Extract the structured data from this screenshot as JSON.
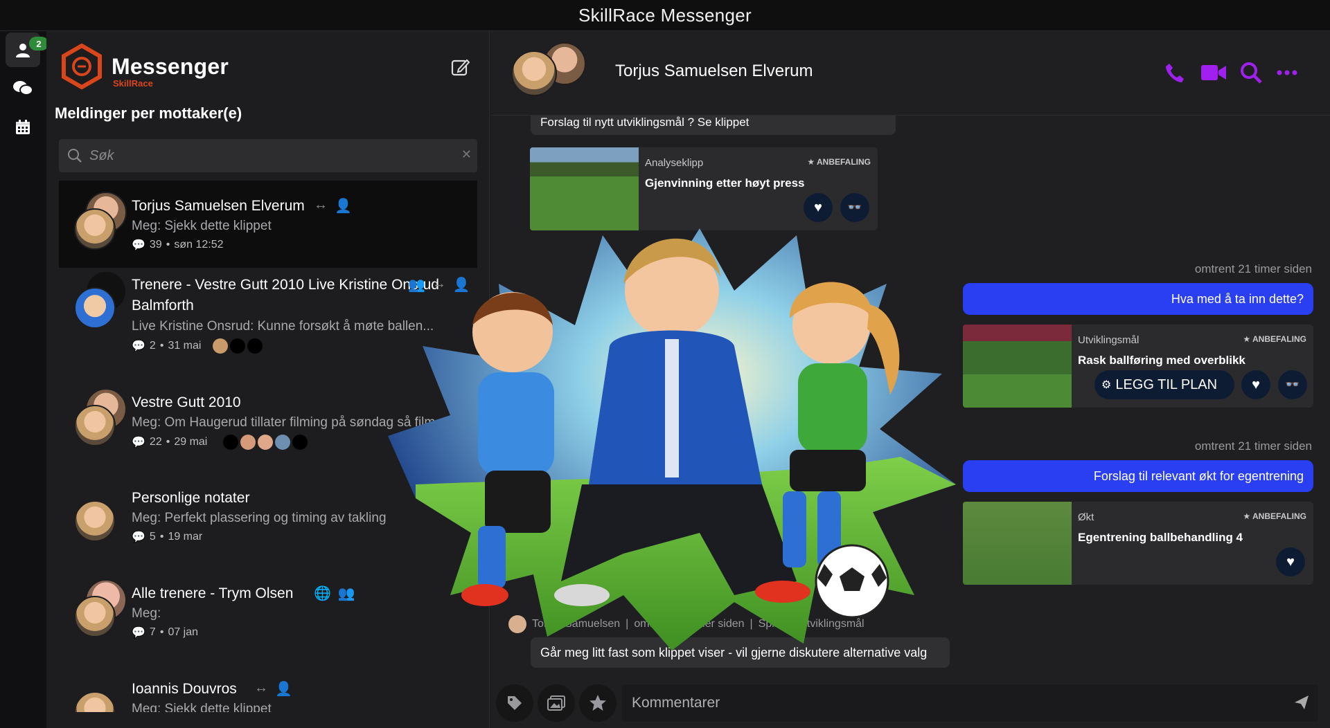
{
  "window": {
    "title": "SkillRace Messenger"
  },
  "rail": {
    "badge": "2"
  },
  "brand": {
    "name": "Messenger",
    "sub": "SkillRace"
  },
  "sidebar": {
    "section_title": "Meldinger per mottaker(e)",
    "search_placeholder": "Søk",
    "conversations": [
      {
        "name": "Torjus Samuelsen Elverum",
        "preview": "Meg: Sjekk dette klippet",
        "count": "39",
        "date": "søn 12:52"
      },
      {
        "name": "Trenere - Vestre Gutt 2010 Live Kristine Onsrud Balmforth",
        "preview": "Live Kristine Onsrud: Kunne forsøkt å møte ballen...",
        "count": "2",
        "date": "31 mai"
      },
      {
        "name": "Vestre Gutt 2010",
        "preview": "Meg: Om Haugerud tillater filming på søndag så film...",
        "count": "22",
        "date": "29 mai"
      },
      {
        "name": "Personlige notater",
        "preview": "Meg: Perfekt plassering og timing av takling",
        "count": "5",
        "date": "19 mar"
      },
      {
        "name": "Alle trenere - Trym Olsen",
        "preview": "Meg:",
        "count": "7",
        "date": "07 jan"
      },
      {
        "name": "Ioannis Douvros",
        "preview": "Meg: Sjekk dette klippet",
        "count": "",
        "date": ""
      }
    ]
  },
  "chat": {
    "title": "Torjus Samuelsen Elverum",
    "partial_message": "Forslag til nytt utviklingsmål ? Se klippet",
    "cards": [
      {
        "type": "Analyseklipp",
        "rec": "ANBEFALING",
        "title": "Gjenvinning etter høyt press"
      },
      {
        "type": "Utviklingsmål",
        "rec": "ANBEFALING",
        "title": "Rask ballføring med overblikk",
        "plan_label": "LEGG TIL PLAN"
      },
      {
        "type": "Økt",
        "rec": "ANBEFALING",
        "title": "Egentrening ballbehandling 4"
      }
    ],
    "timestamps": [
      "omtrent 21 timer siden",
      "omtrent 21 timer siden"
    ],
    "outgoing": [
      "Hva med å ta inn dette?",
      "Forslag til relevant økt for egentrening"
    ],
    "incoming_meta": {
      "author": "Torjus Samuelsen",
      "time": "omtrent 21 timer siden",
      "role": "Spiller - Utviklingsmål"
    },
    "incoming_text": "Går meg litt fast som klippet viser - vil gjerne diskutere alternative valg",
    "composer_placeholder": "Kommentarer"
  },
  "colors": {
    "accent": "#a020f0",
    "bubble": "#2a3ff2",
    "brand": "#d9461c"
  }
}
